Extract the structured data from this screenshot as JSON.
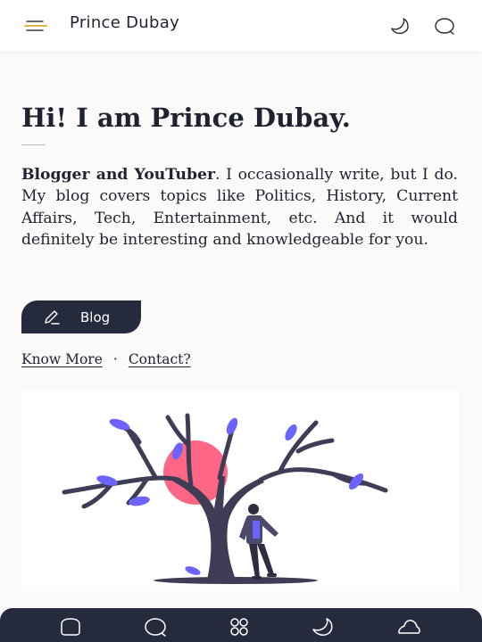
{
  "header": {
    "site_title": "Prince Dubay",
    "icons": [
      "menu-icon",
      "moon-icon",
      "search-icon"
    ]
  },
  "hero": {
    "headline": "Hi! I am Prince Dubay.",
    "bio_strong": "Blogger and YouTuber",
    "bio_rest": ". I occasionally write, but I do. My blog covers topics like Politics, History, Current Affairs, Tech, Entertainment, etc. And it would definitely be interesting and knowledgeable for you.",
    "blog_button": "Blog",
    "know_more": "Know More",
    "separator": "·",
    "contact": "Contact?"
  },
  "illustration": {
    "description_icon": "person-leaning-on-tree-illustration",
    "colors": {
      "trunk": "#3f3d56",
      "leaves": "#6c63ff",
      "sun": "#ff6584"
    }
  },
  "bottom_nav": {
    "icons": [
      "home-icon",
      "search-icon",
      "grid-icon",
      "moon-icon",
      "cloud-icon"
    ]
  },
  "colors": {
    "accent_dark": "#252a3d",
    "menu_accent": "#e0a93a",
    "background": "#fbfaf8"
  }
}
